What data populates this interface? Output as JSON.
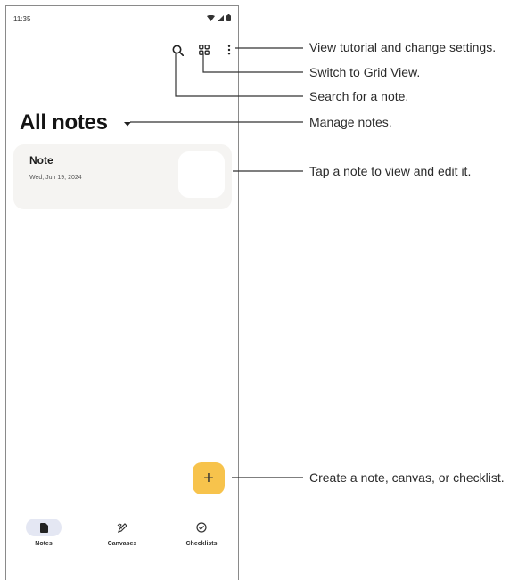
{
  "status_bar": {
    "time": "11:35"
  },
  "page_title": "All notes",
  "note": {
    "title": "Note",
    "date": "Wed, Jun 19, 2024"
  },
  "fab": {
    "label": "+"
  },
  "bottom_nav": [
    {
      "label": "Notes",
      "icon": "note-icon",
      "active": true
    },
    {
      "label": "Canvases",
      "icon": "pen-icon",
      "active": false
    },
    {
      "label": "Checklists",
      "icon": "check-circle-icon",
      "active": false
    }
  ],
  "callouts": {
    "settings": "View tutorial and change settings.",
    "grid": "Switch to Grid View.",
    "search": "Search for a note.",
    "manage": "Manage notes.",
    "tap_note": "Tap a note to view and edit it.",
    "create": "Create a note, canvas, or checklist."
  },
  "colors": {
    "fab": "#f7c34c",
    "card": "#f5f4f2",
    "active_nav": "#e4e7f3"
  }
}
